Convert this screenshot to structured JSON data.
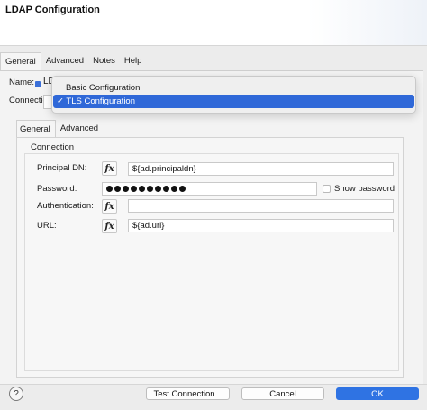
{
  "window": {
    "title": "LDAP Configuration"
  },
  "top_tabs": [
    {
      "label": "General",
      "active": true
    },
    {
      "label": "Advanced",
      "active": false
    },
    {
      "label": "Notes",
      "active": false
    },
    {
      "label": "Help",
      "active": false
    }
  ],
  "form": {
    "name_label": "Name:",
    "name_value": "LD",
    "connection_label": "Connection"
  },
  "dropdown": {
    "options": [
      {
        "label": "Basic Configuration",
        "selected": false
      },
      {
        "label": "✓ TLS Configuration",
        "selected": true
      }
    ],
    "selected_color": "#2f68d8"
  },
  "inner_tabs": [
    {
      "label": "General",
      "active": true
    },
    {
      "label": "Advanced",
      "active": false
    }
  ],
  "connection_section": {
    "title": "Connection",
    "fx_label": "fx",
    "fields": {
      "principal_dn": {
        "label": "Principal DN:",
        "value": "${ad.principaldn}"
      },
      "password": {
        "label": "Password:",
        "mask_count": 10,
        "show_password_label": "Show password",
        "show_password_checked": false
      },
      "authentication": {
        "label": "Authentication:",
        "value": ""
      },
      "url": {
        "label": "URL:",
        "value": "${ad.url}"
      }
    }
  },
  "footer": {
    "help_icon": "question-mark-circle-icon",
    "help_glyph": "?",
    "test_connection_label": "Test Connection...",
    "cancel_label": "Cancel",
    "ok_label": "OK",
    "primary_color": "#2f73e3"
  }
}
